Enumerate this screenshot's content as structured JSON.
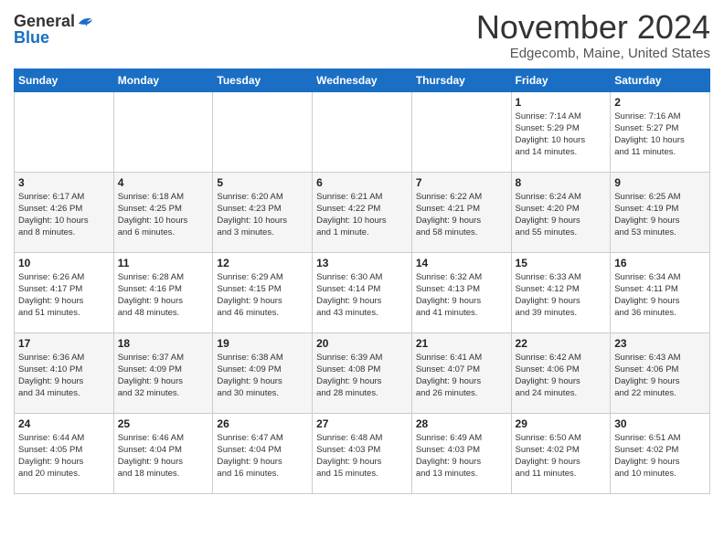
{
  "logo": {
    "general": "General",
    "blue": "Blue"
  },
  "header": {
    "month": "November 2024",
    "location": "Edgecomb, Maine, United States"
  },
  "weekdays": [
    "Sunday",
    "Monday",
    "Tuesday",
    "Wednesday",
    "Thursday",
    "Friday",
    "Saturday"
  ],
  "weeks": [
    [
      {
        "day": "",
        "info": ""
      },
      {
        "day": "",
        "info": ""
      },
      {
        "day": "",
        "info": ""
      },
      {
        "day": "",
        "info": ""
      },
      {
        "day": "",
        "info": ""
      },
      {
        "day": "1",
        "info": "Sunrise: 7:14 AM\nSunset: 5:29 PM\nDaylight: 10 hours\nand 14 minutes."
      },
      {
        "day": "2",
        "info": "Sunrise: 7:16 AM\nSunset: 5:27 PM\nDaylight: 10 hours\nand 11 minutes."
      }
    ],
    [
      {
        "day": "3",
        "info": "Sunrise: 6:17 AM\nSunset: 4:26 PM\nDaylight: 10 hours\nand 8 minutes."
      },
      {
        "day": "4",
        "info": "Sunrise: 6:18 AM\nSunset: 4:25 PM\nDaylight: 10 hours\nand 6 minutes."
      },
      {
        "day": "5",
        "info": "Sunrise: 6:20 AM\nSunset: 4:23 PM\nDaylight: 10 hours\nand 3 minutes."
      },
      {
        "day": "6",
        "info": "Sunrise: 6:21 AM\nSunset: 4:22 PM\nDaylight: 10 hours\nand 1 minute."
      },
      {
        "day": "7",
        "info": "Sunrise: 6:22 AM\nSunset: 4:21 PM\nDaylight: 9 hours\nand 58 minutes."
      },
      {
        "day": "8",
        "info": "Sunrise: 6:24 AM\nSunset: 4:20 PM\nDaylight: 9 hours\nand 55 minutes."
      },
      {
        "day": "9",
        "info": "Sunrise: 6:25 AM\nSunset: 4:19 PM\nDaylight: 9 hours\nand 53 minutes."
      }
    ],
    [
      {
        "day": "10",
        "info": "Sunrise: 6:26 AM\nSunset: 4:17 PM\nDaylight: 9 hours\nand 51 minutes."
      },
      {
        "day": "11",
        "info": "Sunrise: 6:28 AM\nSunset: 4:16 PM\nDaylight: 9 hours\nand 48 minutes."
      },
      {
        "day": "12",
        "info": "Sunrise: 6:29 AM\nSunset: 4:15 PM\nDaylight: 9 hours\nand 46 minutes."
      },
      {
        "day": "13",
        "info": "Sunrise: 6:30 AM\nSunset: 4:14 PM\nDaylight: 9 hours\nand 43 minutes."
      },
      {
        "day": "14",
        "info": "Sunrise: 6:32 AM\nSunset: 4:13 PM\nDaylight: 9 hours\nand 41 minutes."
      },
      {
        "day": "15",
        "info": "Sunrise: 6:33 AM\nSunset: 4:12 PM\nDaylight: 9 hours\nand 39 minutes."
      },
      {
        "day": "16",
        "info": "Sunrise: 6:34 AM\nSunset: 4:11 PM\nDaylight: 9 hours\nand 36 minutes."
      }
    ],
    [
      {
        "day": "17",
        "info": "Sunrise: 6:36 AM\nSunset: 4:10 PM\nDaylight: 9 hours\nand 34 minutes."
      },
      {
        "day": "18",
        "info": "Sunrise: 6:37 AM\nSunset: 4:09 PM\nDaylight: 9 hours\nand 32 minutes."
      },
      {
        "day": "19",
        "info": "Sunrise: 6:38 AM\nSunset: 4:09 PM\nDaylight: 9 hours\nand 30 minutes."
      },
      {
        "day": "20",
        "info": "Sunrise: 6:39 AM\nSunset: 4:08 PM\nDaylight: 9 hours\nand 28 minutes."
      },
      {
        "day": "21",
        "info": "Sunrise: 6:41 AM\nSunset: 4:07 PM\nDaylight: 9 hours\nand 26 minutes."
      },
      {
        "day": "22",
        "info": "Sunrise: 6:42 AM\nSunset: 4:06 PM\nDaylight: 9 hours\nand 24 minutes."
      },
      {
        "day": "23",
        "info": "Sunrise: 6:43 AM\nSunset: 4:06 PM\nDaylight: 9 hours\nand 22 minutes."
      }
    ],
    [
      {
        "day": "24",
        "info": "Sunrise: 6:44 AM\nSunset: 4:05 PM\nDaylight: 9 hours\nand 20 minutes."
      },
      {
        "day": "25",
        "info": "Sunrise: 6:46 AM\nSunset: 4:04 PM\nDaylight: 9 hours\nand 18 minutes."
      },
      {
        "day": "26",
        "info": "Sunrise: 6:47 AM\nSunset: 4:04 PM\nDaylight: 9 hours\nand 16 minutes."
      },
      {
        "day": "27",
        "info": "Sunrise: 6:48 AM\nSunset: 4:03 PM\nDaylight: 9 hours\nand 15 minutes."
      },
      {
        "day": "28",
        "info": "Sunrise: 6:49 AM\nSunset: 4:03 PM\nDaylight: 9 hours\nand 13 minutes."
      },
      {
        "day": "29",
        "info": "Sunrise: 6:50 AM\nSunset: 4:02 PM\nDaylight: 9 hours\nand 11 minutes."
      },
      {
        "day": "30",
        "info": "Sunrise: 6:51 AM\nSunset: 4:02 PM\nDaylight: 9 hours\nand 10 minutes."
      }
    ]
  ]
}
